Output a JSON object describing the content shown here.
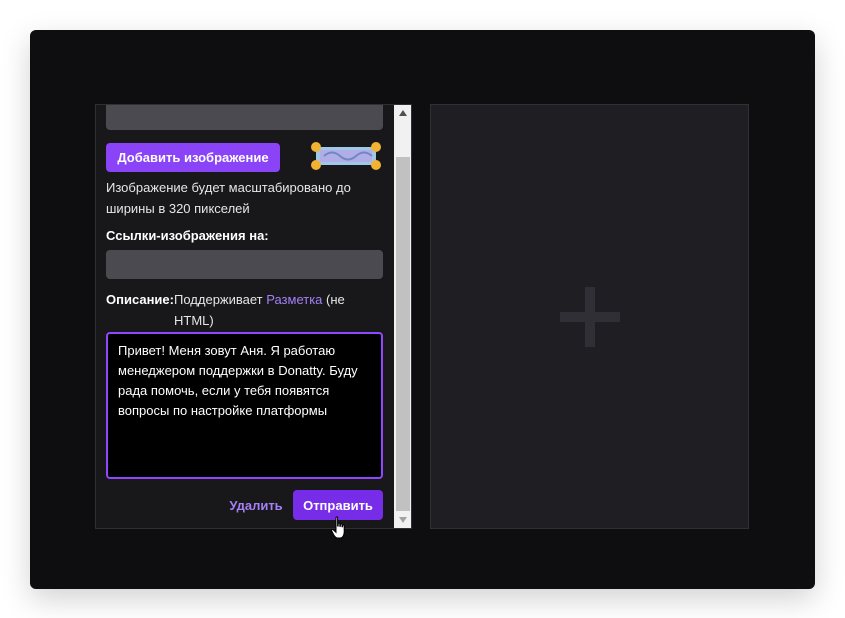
{
  "editor": {
    "add_image_button": "Добавить изображение",
    "image_hint": "Изображение будет масштабировано до ширины в 320 пикселей",
    "links_label": "Ссылки-изображения на:",
    "description_label": "Описание:",
    "description_hint_prefix": "Поддерживает ",
    "description_hint_link": "Разметка",
    "description_hint_suffix": " (не HTML)",
    "description_text": "Привет! Меня зовут Аня. Я работаю менеджером поддержки в Donatty. Буду рада помочь, если у тебя появятся вопросы по настройке платформы",
    "delete_button": "Удалить",
    "send_button": "Отправить"
  },
  "colors": {
    "accent": "#9147ff",
    "send": "#772ce8",
    "link": "#a47ff5",
    "panel": "#18181b",
    "background": "#0e0e10"
  },
  "icons": {
    "plus": "plus-icon",
    "cursor": "hand-pointer-icon",
    "scroll_up": "arrow-up-icon",
    "scroll_down": "arrow-down-icon"
  }
}
